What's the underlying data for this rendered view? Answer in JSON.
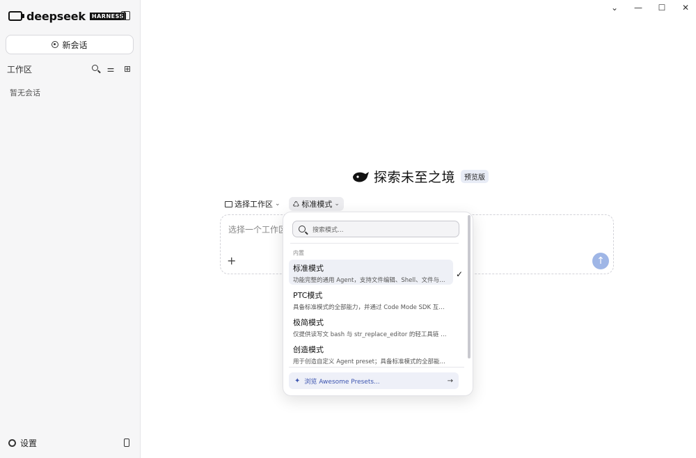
{
  "app": {
    "logo_text": "deepseek",
    "logo_badge": "HARNESS"
  },
  "sidebar": {
    "new_chat_label": "新会话",
    "workspace_label": "工作区",
    "empty_label": "暂无会话",
    "settings_label": "设置"
  },
  "window_controls": {
    "dropdown": "⌄",
    "minimize": "—",
    "maximize": "☐",
    "close": "✕"
  },
  "main": {
    "hero_title": "探索未至之境",
    "hero_badge": "预览版",
    "workspace_select_label": "选择工作区",
    "mode_label": "标准模式",
    "composer_placeholder": "选择一个工作区",
    "attach_label": "+",
    "send_glyph": "↑"
  },
  "dropdown": {
    "search_placeholder": "搜索模式...",
    "section_label": "内置",
    "items": [
      {
        "name": "标准模式",
        "desc": "功能完整的通用 Agent，支持文件编辑、Shell、文件与网...",
        "selected": true
      },
      {
        "name": "PTC模式",
        "desc": "具备标准模式的全部能力，并通过 Code Mode SDK 互动...",
        "selected": false
      },
      {
        "name": "极简模式",
        "desc": "仅提供读写文 bash 与 str_replace_editor 的轻工具链 Agen...",
        "selected": false
      },
      {
        "name": "创造模式",
        "desc": "用于创造自定义 Agent preset；具备标准模式的全部能力...",
        "selected": false
      }
    ],
    "footer_label": "浏览 Awesome Presets...",
    "footer_arrow": "→"
  },
  "icons": {
    "logo": "deepseek-logo-icon",
    "panel": "sidebar-toggle-icon",
    "search": "search-icon",
    "filter": "sliders-icon",
    "new_folder": "new-folder-icon",
    "settings": "gear-icon",
    "mobile": "phone-icon",
    "whale": "whale-icon",
    "folder": "folder-icon",
    "mode": "mode-icon",
    "check": "check-icon",
    "sparkle": "sparkle-icon"
  },
  "colors": {
    "sidebar_bg": "#f6f6f7",
    "send_button": "#9fb6e6",
    "selected_item_bg": "#eef0f6",
    "footer_link": "#3d55b0"
  }
}
